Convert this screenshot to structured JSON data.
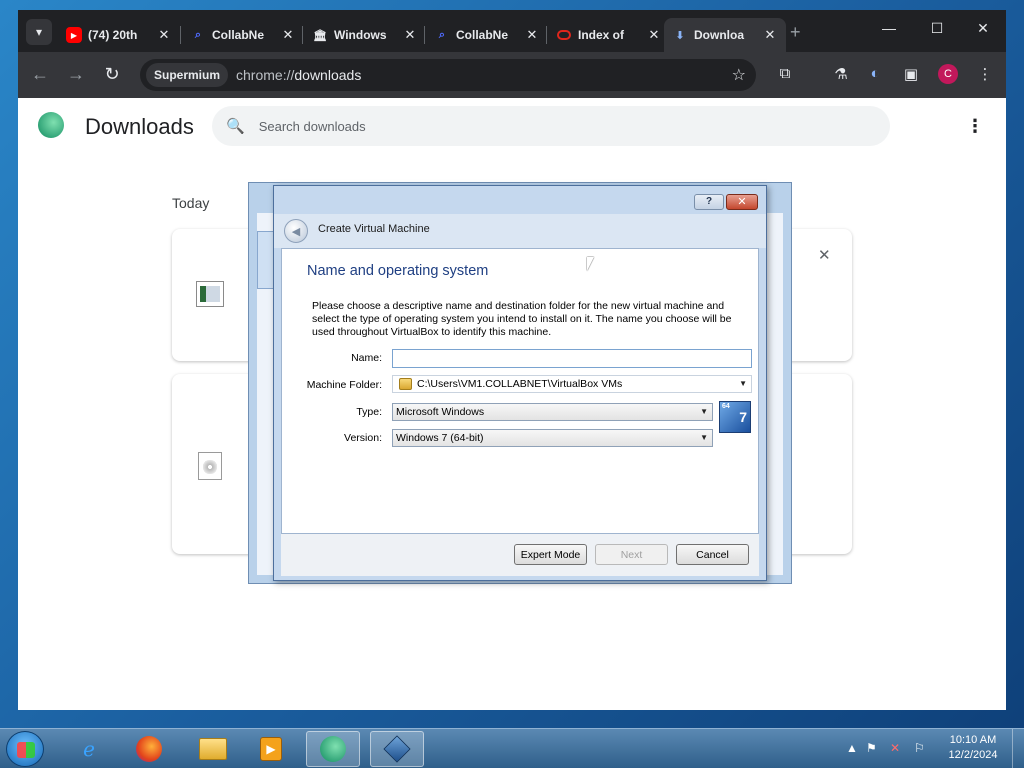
{
  "browser": {
    "tabs": [
      {
        "label": "(74) 20th",
        "icon": "youtube-icon",
        "color": "#ff0000"
      },
      {
        "label": "CollabNe",
        "icon": "search-icon",
        "color": "#4f6bff"
      },
      {
        "label": "Windows",
        "icon": "building-icon",
        "color": "#e8eaed"
      },
      {
        "label": "CollabNe",
        "icon": "search-icon",
        "color": "#4f6bff"
      },
      {
        "label": "Index of",
        "icon": "oracle-icon",
        "color": "#e0261c"
      },
      {
        "label": "Downloa",
        "icon": "download-icon",
        "color": "#8ab4f8"
      }
    ],
    "new_tab": "+",
    "omnibox": {
      "chip": "Supermium",
      "scheme": "chrome://",
      "path": "downloads"
    },
    "profile_initial": "C"
  },
  "downloads_page": {
    "title": "Downloads",
    "search_placeholder": "Search downloads",
    "day_label": "Today"
  },
  "dialog": {
    "caption": "Create Virtual Machine",
    "help_label": "?",
    "close_label": "✕",
    "step_title": "Name and operating system",
    "description": "Please choose a descriptive name and destination folder for the new virtual machine and select the type of operating system you intend to install on it. The name you choose will be used throughout VirtualBox to identify this machine.",
    "fields": {
      "name_label": "Name:",
      "name_value": "",
      "folder_label": "Machine Folder:",
      "folder_value": "C:\\Users\\VM1.COLLABNET\\VirtualBox VMs",
      "type_label": "Type:",
      "type_value": "Microsoft Windows",
      "version_label": "Version:",
      "version_value": "Windows 7 (64-bit)"
    },
    "os_icon": {
      "badge": "64",
      "number": "7"
    },
    "buttons": {
      "expert": "Expert Mode",
      "next": "Next",
      "cancel": "Cancel"
    }
  },
  "taskbar": {
    "clock_time": "10:10 AM",
    "clock_date": "12/2/2024"
  }
}
